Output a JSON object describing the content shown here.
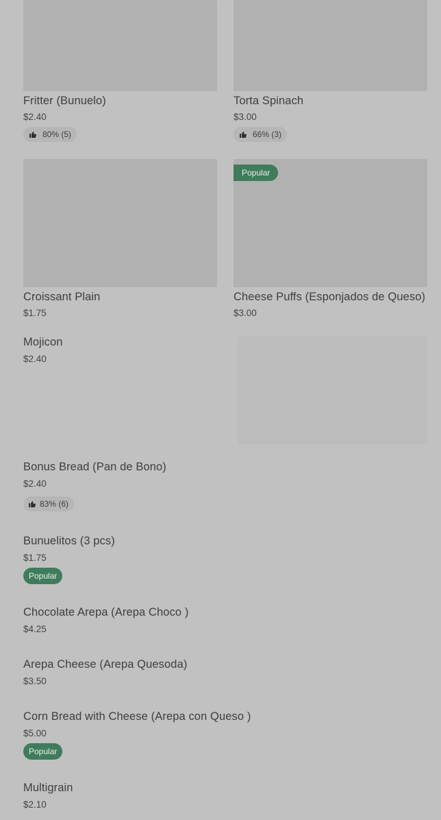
{
  "items": [
    {
      "name": "Fritter (Bunuelo)",
      "price": "$2.40",
      "rating": "80% (5)"
    },
    {
      "name": "Torta Spinach",
      "price": "$3.00",
      "rating": "66% (3)"
    },
    {
      "name": "Croissant Plain",
      "price": "$1.75"
    },
    {
      "name": "Cheese Puffs (Esponjados de Queso)",
      "price": "$3.00",
      "badge": "Popular"
    },
    {
      "name": "Mojicon",
      "price": "$2.40"
    },
    {
      "name": "Bonus Bread (Pan de Bono)",
      "price": "$2.40",
      "rating": "83% (6)"
    },
    {
      "name": "Bunuelitos (3 pcs)",
      "price": "$1.75",
      "badge": "Popular"
    },
    {
      "name": "Chocolate Arepa (Arepa Choco )",
      "price": "$4.25"
    },
    {
      "name": "Arepa Cheese (Arepa Quesoda)",
      "price": "$3.50"
    },
    {
      "name": "Corn Bread with Cheese (Arepa con Queso )",
      "price": "$5.00",
      "badge": "Popular"
    },
    {
      "name": "Multigrain",
      "price": "$2.10"
    }
  ],
  "icons": {
    "rating": "thumbs-up-icon"
  },
  "colors": {
    "background": "#c1c1c1",
    "badge": "#3f7c5c"
  }
}
